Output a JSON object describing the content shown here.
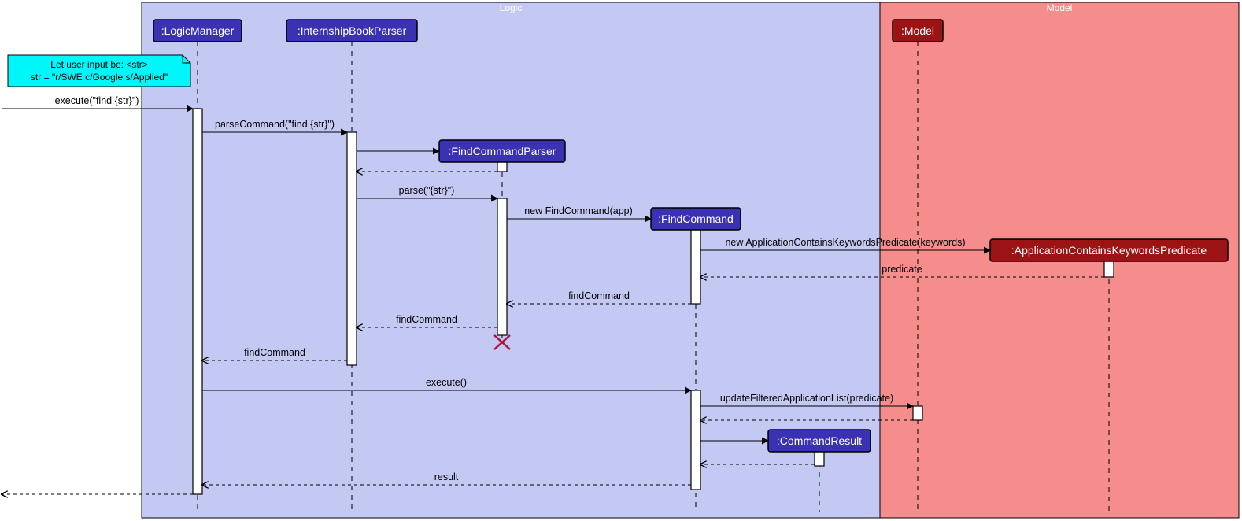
{
  "regions": {
    "logic": "Logic",
    "model": "Model"
  },
  "participants": {
    "logicManager": ":LogicManager",
    "internshipBookParser": ":InternshipBookParser",
    "findCommandParser": ":FindCommandParser",
    "findCommand": ":FindCommand",
    "commandResult": ":CommandResult",
    "model": ":Model",
    "predicate": ":ApplicationContainsKeywordsPredicate"
  },
  "note": {
    "line1": "Let user input be: <str>",
    "line2": "str = \"r/SWE c/Google s/Applied\""
  },
  "messages": {
    "m1": "execute(\"find {str}\")",
    "m2": "parseCommand(\"find {str}\")",
    "m3": "parse(\"{str}\")",
    "m4": "new FindCommand(app)",
    "m5": "new ApplicationContainsKeywordsPredicate(keywords)",
    "m6": "predicate",
    "m7": "findCommand",
    "m8": "findCommand",
    "m9": "findCommand",
    "m10": "execute()",
    "m11": "updateFilteredApplicationList(predicate)",
    "m12": "result"
  }
}
